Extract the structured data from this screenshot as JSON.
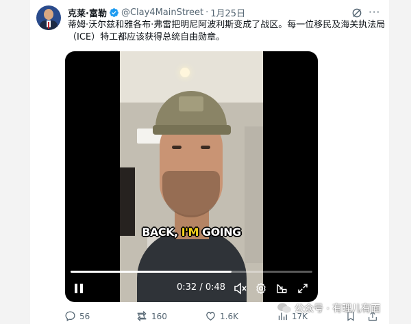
{
  "author": {
    "name": "克莱·富勒",
    "handle": "@Clay4MainStreet",
    "separator": "·",
    "date": "1月25日",
    "avatar_icon": "avatar-portrait",
    "verified_icon": "verified-badge-icon",
    "verified_color": "#1d9bf0"
  },
  "tweet": {
    "text": "蒂姆·沃尔兹和雅各布·弗雷把明尼阿波利斯变成了战区。每一位移民及海关执法局（ICE）特工都应该获得总统自由勋章。"
  },
  "header_icons": [
    "grok-icon",
    "more-icon"
  ],
  "more_label": "···",
  "video": {
    "caption_prefix": "BACK, ",
    "caption_highlight": "I'M",
    "caption_suffix": " GOING",
    "current_time": "0:32",
    "time_separator": "/",
    "duration": "0:48",
    "progress_fraction": 0.667,
    "controls": [
      "pause-icon",
      "volume-muted-icon",
      "settings-icon",
      "pip-icon",
      "fullscreen-icon"
    ]
  },
  "watermark": {
    "text": "公众号 · 有理儿有面",
    "icon": "wechat-icon"
  },
  "actions": {
    "replies": "56",
    "reposts": "160",
    "likes": "1.6K",
    "views": "17K"
  },
  "colors": {
    "text_primary": "#0f1419",
    "text_secondary": "#536471",
    "caption_highlight": "#f6d21e"
  }
}
